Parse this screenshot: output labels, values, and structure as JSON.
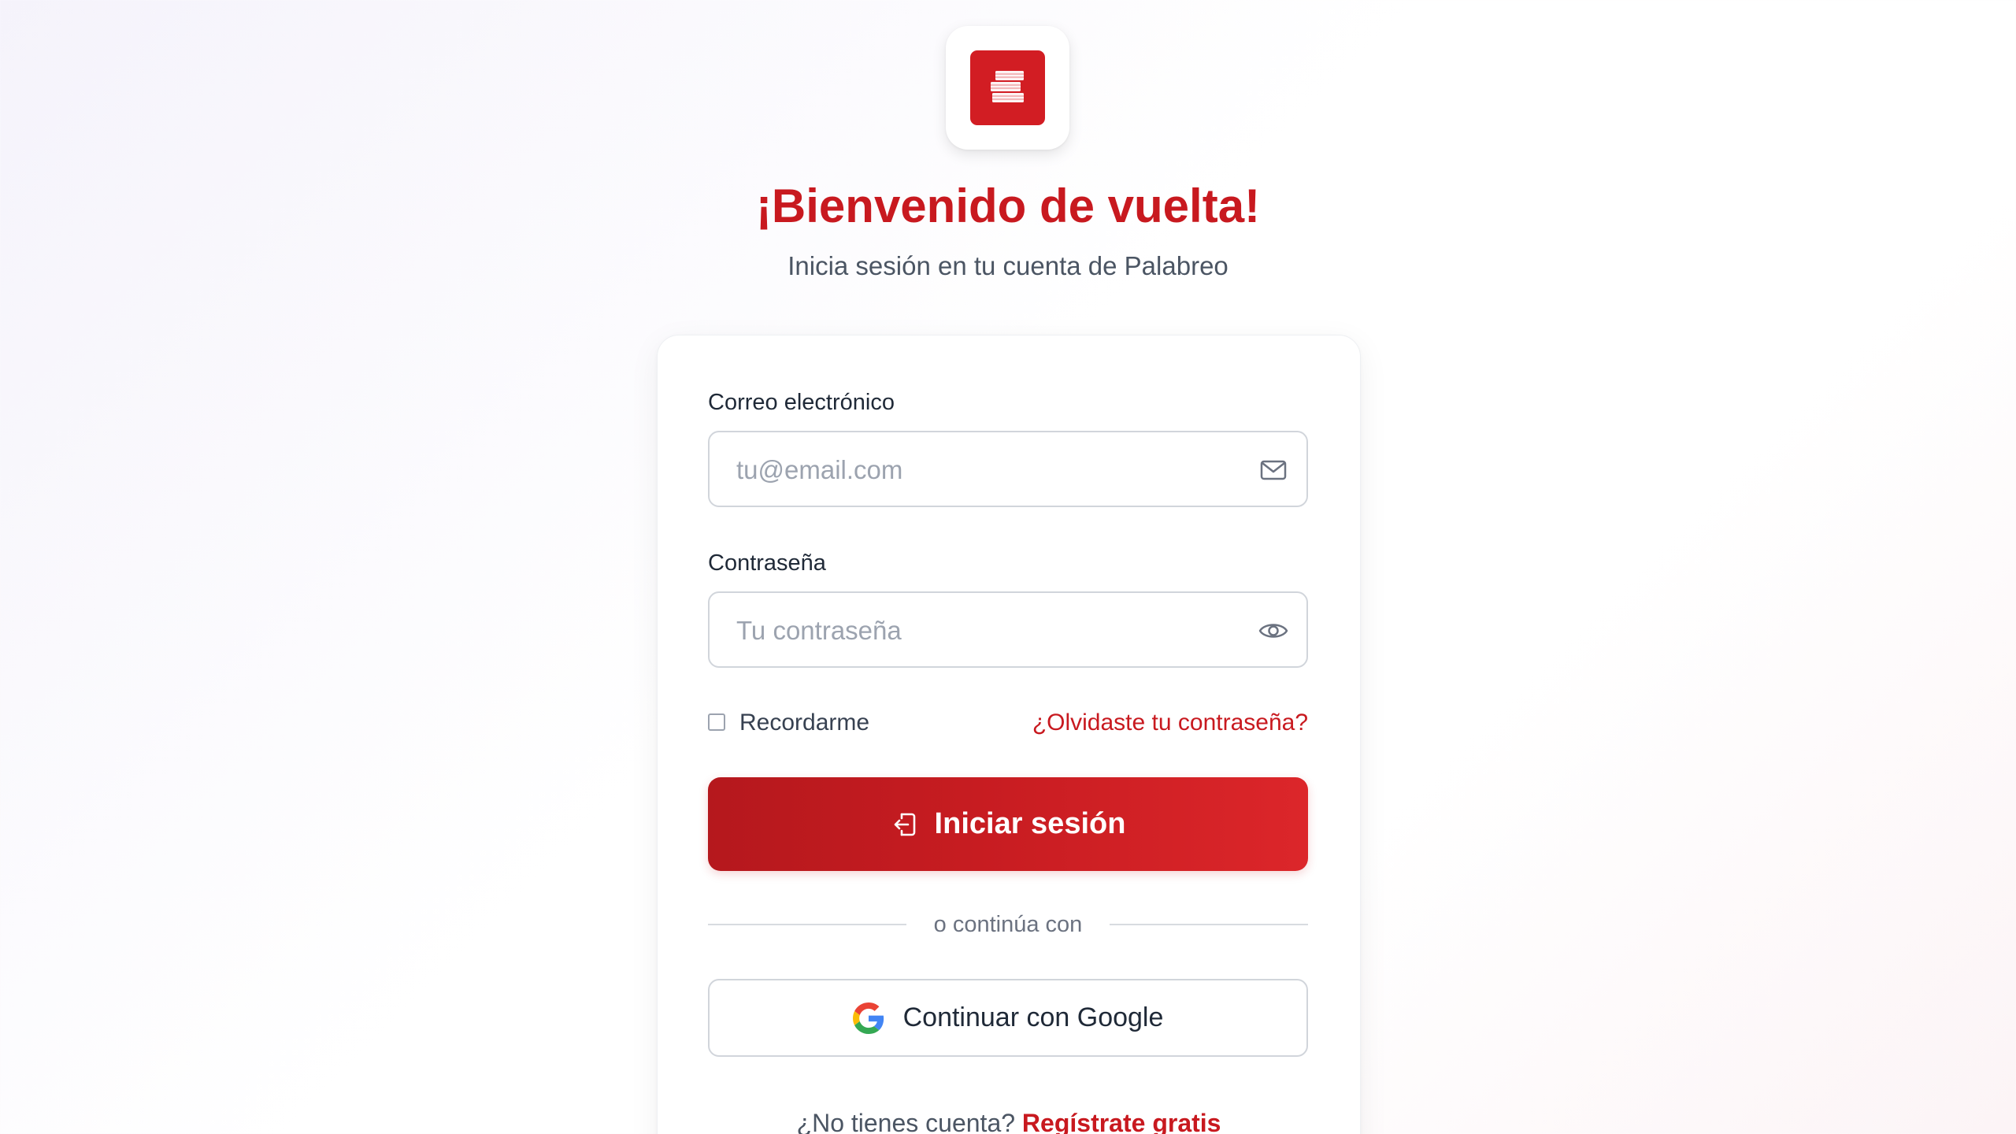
{
  "app": {
    "title": "¡Bienvenido de vuelta!",
    "subtitle": "Inicia sesión en tu cuenta de Palabreo",
    "logo_icon": "books-stack-icon",
    "accent_color": "#c8191f"
  },
  "form": {
    "email": {
      "label": "Correo electrónico",
      "placeholder": "tu@email.com",
      "value": "",
      "icon": "mail-icon"
    },
    "password": {
      "label": "Contraseña",
      "placeholder": "Tu contraseña",
      "value": "",
      "icon": "eye-icon"
    },
    "remember_label": "Recordarme",
    "remember_checked": false,
    "forgot_label": "¿Olvidaste tu contraseña?",
    "submit_label": "Iniciar sesión",
    "submit_icon": "login-icon"
  },
  "divider_text": "o continúa con",
  "google": {
    "label": "Continuar con Google",
    "icon": "google-icon"
  },
  "signup": {
    "prompt": "¿No tienes cuenta?",
    "link_label": "Regístrate gratis"
  }
}
